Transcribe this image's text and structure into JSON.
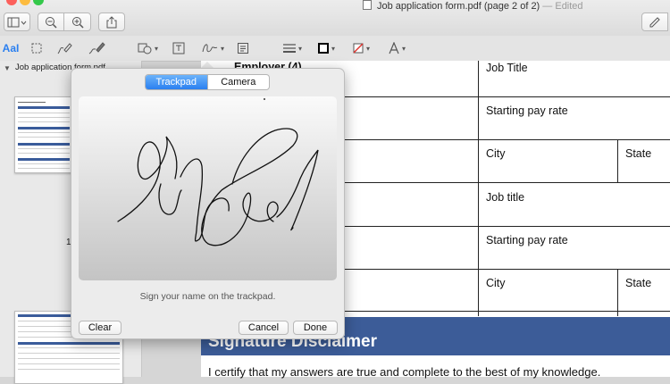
{
  "window": {
    "title": "Job application form.pdf (page 2 of 2)",
    "edited_label": "— Edited",
    "traffic_colors": [
      "#fc605c",
      "#fdbc40",
      "#34c84a"
    ]
  },
  "toolbar": {
    "icons": [
      "sidebar-toggle-icon",
      "zoom-out-icon",
      "zoom-in-icon",
      "share-icon",
      "pen-icon"
    ]
  },
  "markup": {
    "text_style_label": "AaI",
    "accent": "#2a7ff0"
  },
  "sidebar": {
    "doc_title": "Job application form.pdf",
    "page_number": "1"
  },
  "form": {
    "employer_label": "Employer (4)",
    "job_title_label": "Job Title",
    "starting_pay_label": "Starting pay rate",
    "city_label": "City",
    "state_label": "State",
    "job_title_label_2": "Job title",
    "starting_pay_label_2": "Starting pay rate",
    "city_label_2": "City",
    "state_label_2": "State",
    "disclaimer_title": "Signature Disclaimer",
    "certify_text": "I certify that my answers are true and complete to the best of my knowledge.",
    "header_color": "#3c5c98"
  },
  "signature_popover": {
    "tab_trackpad": "Trackpad",
    "tab_camera": "Camera",
    "selected_tab": "Trackpad",
    "hint": "Sign your name on the trackpad.",
    "clear_label": "Clear",
    "cancel_label": "Cancel",
    "done_label": "Done"
  }
}
